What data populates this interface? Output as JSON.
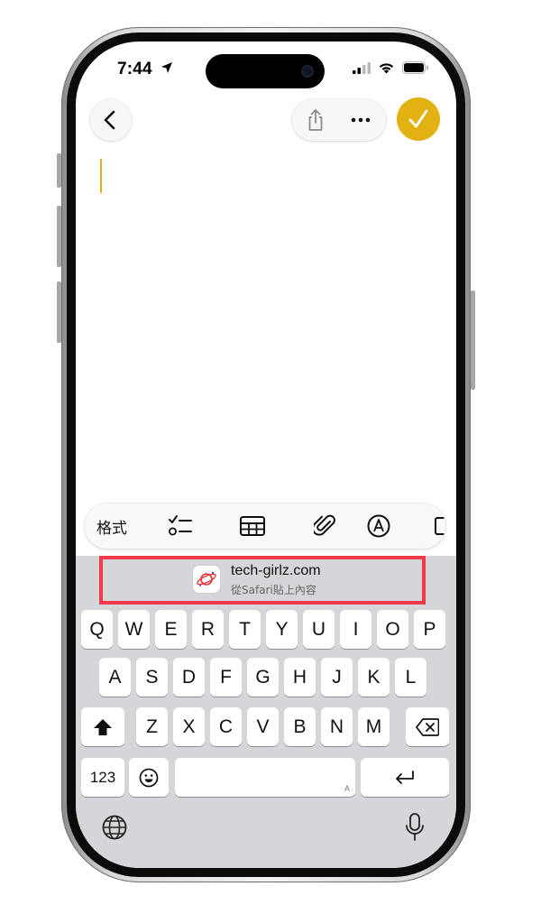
{
  "status_bar": {
    "time": "7:44"
  },
  "toolbar": {
    "back_icon": "chevron-left-icon",
    "share_icon": "share-icon",
    "more_icon": "ellipsis-icon",
    "done_icon": "checkmark-icon",
    "accent_color": "#e3b212"
  },
  "format_bar": {
    "format_label": "格式",
    "items": [
      "checklist-icon",
      "table-icon",
      "paperclip-icon",
      "markup-pen-icon"
    ]
  },
  "paste_suggestion": {
    "title": "tech-girlz.com",
    "subtitle": "從Safari貼上內容",
    "highlight_color": "#f0394b"
  },
  "keyboard": {
    "row1": [
      "Q",
      "W",
      "E",
      "R",
      "T",
      "Y",
      "U",
      "I",
      "O",
      "P"
    ],
    "row2": [
      "A",
      "S",
      "D",
      "F",
      "G",
      "H",
      "J",
      "K",
      "L"
    ],
    "row3": [
      "Z",
      "X",
      "C",
      "V",
      "B",
      "N",
      "M"
    ],
    "numbers_label": "123",
    "space_hint": "A"
  }
}
